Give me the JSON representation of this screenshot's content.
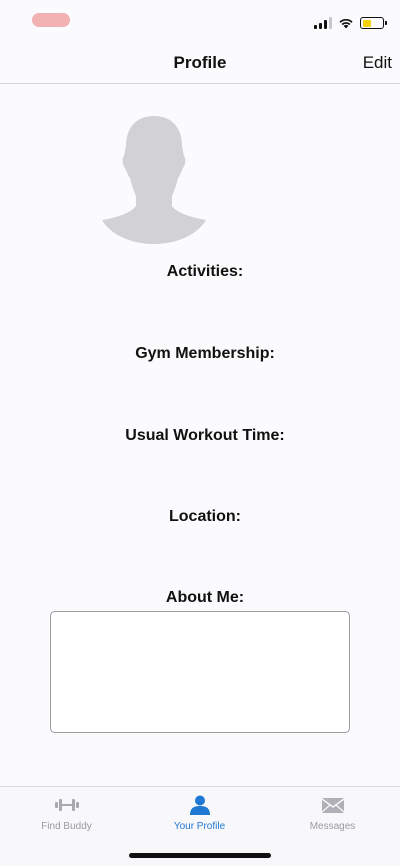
{
  "nav": {
    "title": "Profile",
    "edit_label": "Edit"
  },
  "status": {
    "battery_level": 0.45,
    "wifi": "wifi-icon",
    "signal_bars": 3
  },
  "fields": {
    "activities": "Activities:",
    "gym_membership": "Gym Membership:",
    "workout_time": "Usual Workout Time:",
    "location": "Location:",
    "about_me": "About Me:"
  },
  "about_me_text": "",
  "tabs": [
    {
      "label": "Find Buddy",
      "icon": "dumbbell-icon",
      "active": false
    },
    {
      "label": "Your Profile",
      "icon": "person-icon",
      "active": true
    },
    {
      "label": "Messages",
      "icon": "envelope-icon",
      "active": false
    }
  ],
  "colors": {
    "accent": "#1f78d1",
    "inactive": "#9a9aa0",
    "battery": "#f5d20a"
  }
}
